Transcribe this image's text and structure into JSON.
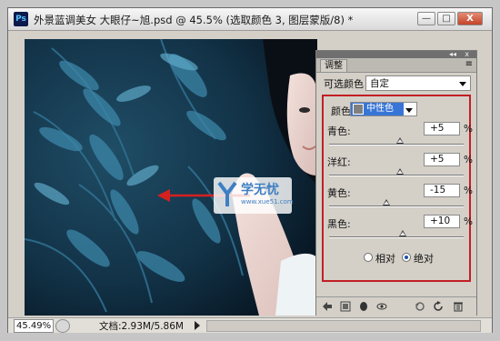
{
  "window": {
    "app_logo": "Ps",
    "title": "外景蓝调美女  大眼仔~旭.psd @ 45.5% (选取颜色 3, 图层蒙版/8) *",
    "minimize_symbol": "—",
    "maximize_symbol": "□",
    "close_symbol": "X"
  },
  "statusbar": {
    "zoom": "45.49%",
    "doc_info": "文档:2.93M/5.86M"
  },
  "watermark": {
    "text": "学无忧",
    "url": "www.xue51.com"
  },
  "panel": {
    "tab": "调整",
    "collapse_symbol": "◂◂",
    "close_symbol": "x",
    "menu_symbol": "≡",
    "preset_label": "可选颜色",
    "preset_value": "自定",
    "colors_label": "颜色:",
    "colors_value": "中性色",
    "sliders": [
      {
        "label": "青色:",
        "value": "+5",
        "unit": "%",
        "level": 0.525
      },
      {
        "label": "洋红:",
        "value": "+5",
        "unit": "%",
        "level": 0.525
      },
      {
        "label": "黄色:",
        "value": "-15",
        "unit": "%",
        "level": 0.425
      },
      {
        "label": "黑色:",
        "value": "+10",
        "unit": "%",
        "level": 0.55
      }
    ],
    "method_relative": "相对",
    "method_absolute": "绝对",
    "method_selected": "绝对"
  },
  "colors": {
    "highlight_box": "#c21f24",
    "arrow": "#d62020",
    "selection_blue": "#3875d7"
  }
}
